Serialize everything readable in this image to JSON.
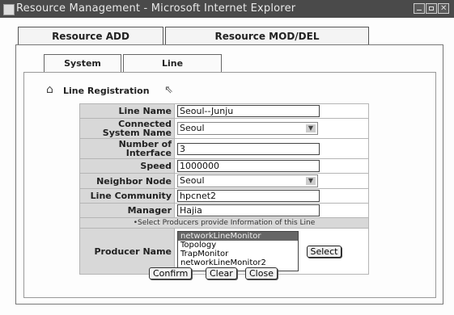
{
  "window": {
    "title": "Resource Management - Microsoft Internet Explorer"
  },
  "tabs": {
    "resource_add": "Resource ADD",
    "resource_mod_del": "Resource MOD/DEL"
  },
  "subtabs": {
    "system": "System",
    "line": "Line"
  },
  "section": {
    "title": "Line Registration"
  },
  "form": {
    "line_name": {
      "label": "Line Name",
      "value": "Seoul--Junju"
    },
    "connected_system": {
      "label": "Connected System Name",
      "value": "Seoul"
    },
    "num_interface": {
      "label": "Number of Interface",
      "value": "3"
    },
    "speed": {
      "label": "Speed",
      "value": "1000000"
    },
    "neighbor_node": {
      "label": "Neighbor Node",
      "value": "Seoul"
    },
    "line_community": {
      "label": "Line Community",
      "value": "hpcnet2"
    },
    "manager": {
      "label": "Manager",
      "value": "Hajia"
    },
    "note": "•Select Producers provide Information of this Line",
    "producer": {
      "label": "Producer Name",
      "options": [
        "networkLineMonitor",
        "Topology",
        "TrapMonitor",
        "networkLineMonitor2"
      ],
      "selected": "networkLineMonitor",
      "select_button": "Select"
    }
  },
  "buttons": {
    "confirm": "Confirm",
    "clear": "Clear",
    "close": "Close"
  }
}
